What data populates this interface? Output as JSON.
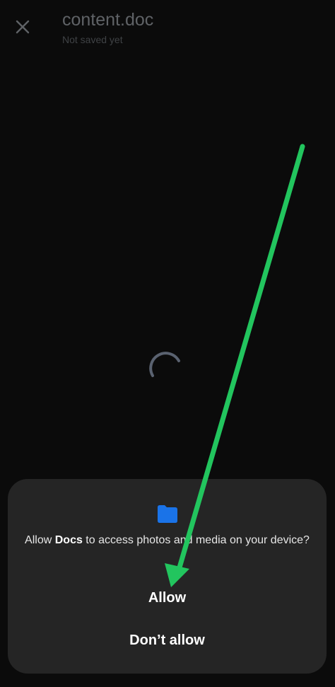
{
  "header": {
    "title": "content.doc",
    "subtitle": "Not saved yet",
    "close_icon": "close-icon"
  },
  "loading": {
    "indicator": "progress-spinner-icon"
  },
  "dialog": {
    "icon": "folder-icon",
    "message_prefix": "Allow ",
    "app_name": "Docs",
    "message_suffix": " to access photos and media on your device?",
    "allow_label": "Allow",
    "deny_label": "Don’t allow"
  },
  "colors": {
    "background": "#0b0b0b",
    "dialog_background": "#252525",
    "folder_blue": "#1a73e8",
    "annotation_arrow": "#22c55e",
    "spinner": "#5a6270"
  }
}
